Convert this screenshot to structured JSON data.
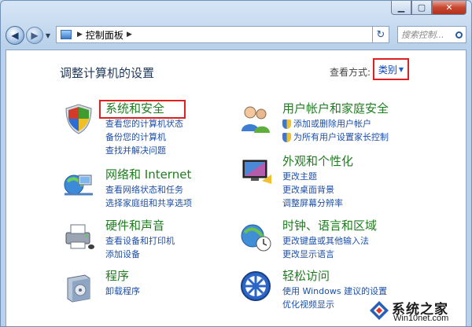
{
  "window": {
    "minimize_glyph": "▁",
    "maximize_glyph": "▢",
    "close_glyph": "✕"
  },
  "nav": {
    "back_glyph": "◀",
    "forward_glyph": "▶",
    "breadcrumb": "控制面板",
    "refresh_glyph": "↻",
    "search_placeholder": "搜索控制..."
  },
  "header": {
    "title": "调整计算机的设置",
    "view_by_label": "查看方式:",
    "view_by_value": "类别"
  },
  "categories": [
    {
      "title": "系统和安全",
      "links": [
        "查看您的计算机状态",
        "备份您的计算机",
        "查找并解决问题"
      ]
    },
    {
      "title": "网络和 Internet",
      "links": [
        "查看网络状态和任务",
        "选择家庭组和共享选项"
      ]
    },
    {
      "title": "硬件和声音",
      "links": [
        "查看设备和打印机",
        "添加设备"
      ]
    },
    {
      "title": "程序",
      "links": [
        "卸载程序"
      ]
    },
    {
      "title": "用户帐户和家庭安全",
      "links": [
        "添加或删除用户帐户",
        "为所有用户设置家长控制"
      ]
    },
    {
      "title": "外观和个性化",
      "links": [
        "更改主题",
        "更改桌面背景",
        "调整屏幕分辨率"
      ]
    },
    {
      "title": "时钟、语言和区域",
      "links": [
        "更改键盘或其他输入法",
        "更改显示语言"
      ]
    },
    {
      "title": "轻松访问",
      "links": [
        "使用 Windows 建议的设置",
        "优化视频显示"
      ]
    }
  ],
  "watermark": {
    "line1": "系统之家",
    "line2": "Win10net.com"
  }
}
